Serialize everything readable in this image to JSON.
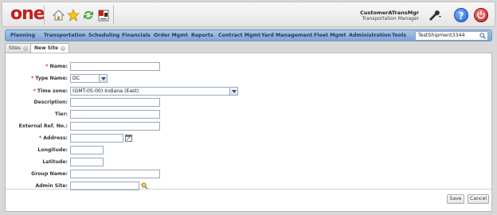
{
  "header": {
    "logo": "one",
    "user_name": "CustomerATransMgr",
    "user_role": "Transportation Manager",
    "icons": [
      "home-icon",
      "star-icon",
      "refresh-icon",
      "report-icon",
      "tools-icon",
      "help-icon",
      "power-icon"
    ],
    "help_glyph": "?"
  },
  "menu": {
    "items": [
      "Planning",
      "Transportation",
      "Scheduling",
      "Financials",
      "Order Mgmt",
      "Reports",
      "Contract Mgmt",
      "Yard Management",
      "Fleet Mgmt",
      "Administration",
      "Tools"
    ],
    "search_value": "TestShipment3344"
  },
  "tabs": [
    {
      "label": "Sites",
      "close": "×"
    },
    {
      "label": "New Site",
      "close": "×"
    }
  ],
  "form": {
    "name": {
      "label": "Name:",
      "required": "*",
      "value": ""
    },
    "type_name": {
      "label": "Type Name:",
      "required": "*",
      "value": "DC"
    },
    "time_zone": {
      "label": "Time zone:",
      "required": "*",
      "value": "(GMT-05:00) Indiana (East)"
    },
    "description": {
      "label": "Description:",
      "value": ""
    },
    "tier": {
      "label": "Tier:",
      "value": ""
    },
    "external_ref": {
      "label": "External Ref. No.:",
      "value": ""
    },
    "address": {
      "label": "Address:",
      "required": "*",
      "value": ""
    },
    "longitude": {
      "label": "Longitude:",
      "value": ""
    },
    "latitude": {
      "label": "Latitude:",
      "value": ""
    },
    "group_name": {
      "label": "Group Name:",
      "value": ""
    },
    "admin_site": {
      "label": "Admin Site:",
      "value": ""
    }
  },
  "actions": {
    "save": "Save",
    "cancel": "Cancel"
  },
  "colors": {
    "menu_bar": "#7da4d2",
    "menu_text": "#1f3c66",
    "logo": "#c41f1f",
    "required": "#d22222"
  }
}
